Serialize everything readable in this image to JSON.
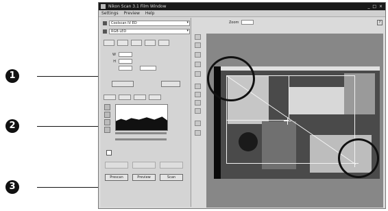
{
  "window": {
    "title": "Nikon Scan 3.1 Film Window",
    "buttons": "_ □ ×"
  },
  "menu": [
    "Settings",
    "Preview",
    "Help"
  ],
  "panel": {
    "scanner_select": "Coolscan IV ED",
    "profile_select": "RGB LED",
    "fields": [
      {
        "label": "W",
        "value": "",
        "unit": ""
      },
      {
        "label": "H",
        "value": "",
        "unit": ""
      },
      {
        "label": "",
        "value": "",
        "unit": ""
      }
    ],
    "reset_label": "",
    "auto_label": "",
    "checkbox_label": "",
    "disabled_buttons": [
      "",
      "",
      ""
    ],
    "bottom_buttons": [
      "Prescan",
      "Preview",
      "Scan"
    ]
  },
  "zoom": {
    "label": "Zoom",
    "value": ""
  },
  "callouts": [
    "1",
    "2",
    "3"
  ]
}
